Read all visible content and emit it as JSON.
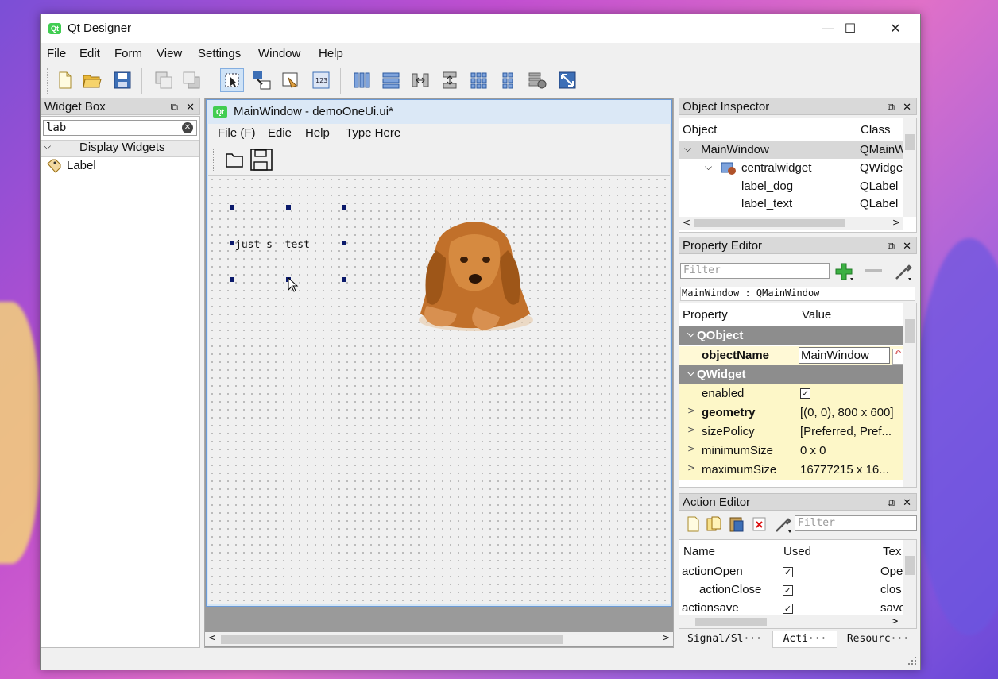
{
  "window": {
    "title": "Qt Designer",
    "app_icon_text": "Qt",
    "min": "—",
    "max": "☐",
    "close": "✕"
  },
  "menubar": [
    "File",
    "Edit",
    "Form",
    "View",
    "Settings",
    "Window",
    "Help"
  ],
  "widget_box": {
    "title": "Widget Box",
    "filter_value": "lab",
    "category": "Display Widgets",
    "items": [
      "Label"
    ]
  },
  "form_window": {
    "title": "MainWindow - demoOneUi.ui*",
    "icon_text": "Qt",
    "menus": [
      "File (F)",
      "Edie",
      "Help",
      "Type Here"
    ],
    "label_text": "just s  test"
  },
  "object_inspector": {
    "title": "Object Inspector",
    "headers": {
      "object": "Object",
      "class": "Class"
    },
    "rows": [
      {
        "object": "MainWindow",
        "class": "QMainW"
      },
      {
        "object": "centralwidget",
        "class": "QWidge"
      },
      {
        "object": "label_dog",
        "class": "QLabel"
      },
      {
        "object": "label_text",
        "class": "QLabel"
      }
    ]
  },
  "property_editor": {
    "title": "Property Editor",
    "filter_placeholder": "Filter",
    "context": "MainWindow : QMainWindow",
    "headers": {
      "property": "Property",
      "value": "Value"
    },
    "groups": {
      "qobject": "QObject",
      "qwidget": "QWidget"
    },
    "rows": [
      {
        "name": "objectName",
        "value": "MainWindow"
      },
      {
        "name": "enabled",
        "value": "✓"
      },
      {
        "name": "geometry",
        "value": "[(0, 0), 800 x 600]"
      },
      {
        "name": "sizePolicy",
        "value": "[Preferred, Pref..."
      },
      {
        "name": "minimumSize",
        "value": "0 x 0"
      },
      {
        "name": "maximumSize",
        "value": "16777215 x 16..."
      }
    ]
  },
  "action_editor": {
    "title": "Action Editor",
    "filter_placeholder": "Filter",
    "headers": {
      "name": "Name",
      "used": "Used",
      "text": "Tex"
    },
    "rows": [
      {
        "name": "actionOpen",
        "used": "✓",
        "text": "Ope"
      },
      {
        "name": "actionClose",
        "used": "✓",
        "text": "clos"
      },
      {
        "name": "actionsave",
        "used": "✓",
        "text": "save"
      }
    ]
  },
  "bottom_tabs": [
    "Signal/Sl···",
    "Acti···",
    "Resourc···"
  ],
  "colors": {
    "accent": "#cfe3f7",
    "group_bg": "#8d8d8d",
    "prop_bg": "#fdf7c8"
  }
}
